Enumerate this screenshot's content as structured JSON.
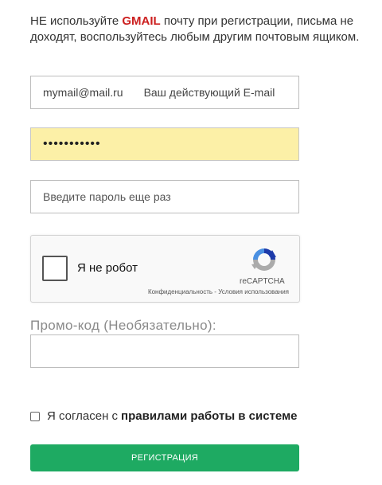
{
  "notice": {
    "prefix": "НЕ используйте ",
    "gmail": "GMAIL",
    "suffix": " почту при регистрации, письма не доходят, воспользуйтесь любым другим почтовым ящиком."
  },
  "email": {
    "value": "mymail@mail.ru",
    "placeholder": "Ваш действующий E-mail"
  },
  "password": {
    "value": "•••••••••••"
  },
  "confirm_password": {
    "placeholder": "Введите пароль еще раз"
  },
  "captcha": {
    "label": "Я не робот",
    "brand": "reCAPTCHA",
    "links": "Конфиденциальность - Условия использования"
  },
  "promo": {
    "label": "Промо-код (Необязательно):",
    "value": ""
  },
  "agree": {
    "text": "Я согласен с",
    "link": "правилами работы в системе"
  },
  "register": {
    "label": "Регистрация"
  },
  "colors": {
    "accent": "#1eaa62",
    "warning": "#cc1f1f",
    "autofill": "#fcf0a7"
  }
}
